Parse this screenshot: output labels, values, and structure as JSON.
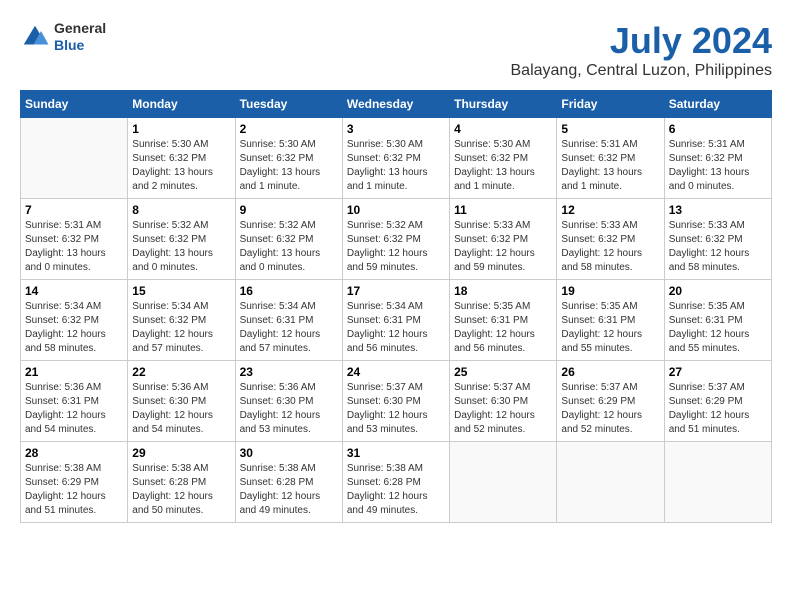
{
  "header": {
    "logo_general": "General",
    "logo_blue": "Blue",
    "main_title": "July 2024",
    "sub_title": "Balayang, Central Luzon, Philippines"
  },
  "calendar": {
    "days_of_week": [
      "Sunday",
      "Monday",
      "Tuesday",
      "Wednesday",
      "Thursday",
      "Friday",
      "Saturday"
    ],
    "weeks": [
      [
        {
          "day": "",
          "info": ""
        },
        {
          "day": "1",
          "info": "Sunrise: 5:30 AM\nSunset: 6:32 PM\nDaylight: 13 hours\nand 2 minutes."
        },
        {
          "day": "2",
          "info": "Sunrise: 5:30 AM\nSunset: 6:32 PM\nDaylight: 13 hours\nand 1 minute."
        },
        {
          "day": "3",
          "info": "Sunrise: 5:30 AM\nSunset: 6:32 PM\nDaylight: 13 hours\nand 1 minute."
        },
        {
          "day": "4",
          "info": "Sunrise: 5:30 AM\nSunset: 6:32 PM\nDaylight: 13 hours\nand 1 minute."
        },
        {
          "day": "5",
          "info": "Sunrise: 5:31 AM\nSunset: 6:32 PM\nDaylight: 13 hours\nand 1 minute."
        },
        {
          "day": "6",
          "info": "Sunrise: 5:31 AM\nSunset: 6:32 PM\nDaylight: 13 hours\nand 0 minutes."
        }
      ],
      [
        {
          "day": "7",
          "info": "Sunrise: 5:31 AM\nSunset: 6:32 PM\nDaylight: 13 hours\nand 0 minutes."
        },
        {
          "day": "8",
          "info": "Sunrise: 5:32 AM\nSunset: 6:32 PM\nDaylight: 13 hours\nand 0 minutes."
        },
        {
          "day": "9",
          "info": "Sunrise: 5:32 AM\nSunset: 6:32 PM\nDaylight: 13 hours\nand 0 minutes."
        },
        {
          "day": "10",
          "info": "Sunrise: 5:32 AM\nSunset: 6:32 PM\nDaylight: 12 hours\nand 59 minutes."
        },
        {
          "day": "11",
          "info": "Sunrise: 5:33 AM\nSunset: 6:32 PM\nDaylight: 12 hours\nand 59 minutes."
        },
        {
          "day": "12",
          "info": "Sunrise: 5:33 AM\nSunset: 6:32 PM\nDaylight: 12 hours\nand 58 minutes."
        },
        {
          "day": "13",
          "info": "Sunrise: 5:33 AM\nSunset: 6:32 PM\nDaylight: 12 hours\nand 58 minutes."
        }
      ],
      [
        {
          "day": "14",
          "info": "Sunrise: 5:34 AM\nSunset: 6:32 PM\nDaylight: 12 hours\nand 58 minutes."
        },
        {
          "day": "15",
          "info": "Sunrise: 5:34 AM\nSunset: 6:32 PM\nDaylight: 12 hours\nand 57 minutes."
        },
        {
          "day": "16",
          "info": "Sunrise: 5:34 AM\nSunset: 6:31 PM\nDaylight: 12 hours\nand 57 minutes."
        },
        {
          "day": "17",
          "info": "Sunrise: 5:34 AM\nSunset: 6:31 PM\nDaylight: 12 hours\nand 56 minutes."
        },
        {
          "day": "18",
          "info": "Sunrise: 5:35 AM\nSunset: 6:31 PM\nDaylight: 12 hours\nand 56 minutes."
        },
        {
          "day": "19",
          "info": "Sunrise: 5:35 AM\nSunset: 6:31 PM\nDaylight: 12 hours\nand 55 minutes."
        },
        {
          "day": "20",
          "info": "Sunrise: 5:35 AM\nSunset: 6:31 PM\nDaylight: 12 hours\nand 55 minutes."
        }
      ],
      [
        {
          "day": "21",
          "info": "Sunrise: 5:36 AM\nSunset: 6:31 PM\nDaylight: 12 hours\nand 54 minutes."
        },
        {
          "day": "22",
          "info": "Sunrise: 5:36 AM\nSunset: 6:30 PM\nDaylight: 12 hours\nand 54 minutes."
        },
        {
          "day": "23",
          "info": "Sunrise: 5:36 AM\nSunset: 6:30 PM\nDaylight: 12 hours\nand 53 minutes."
        },
        {
          "day": "24",
          "info": "Sunrise: 5:37 AM\nSunset: 6:30 PM\nDaylight: 12 hours\nand 53 minutes."
        },
        {
          "day": "25",
          "info": "Sunrise: 5:37 AM\nSunset: 6:30 PM\nDaylight: 12 hours\nand 52 minutes."
        },
        {
          "day": "26",
          "info": "Sunrise: 5:37 AM\nSunset: 6:29 PM\nDaylight: 12 hours\nand 52 minutes."
        },
        {
          "day": "27",
          "info": "Sunrise: 5:37 AM\nSunset: 6:29 PM\nDaylight: 12 hours\nand 51 minutes."
        }
      ],
      [
        {
          "day": "28",
          "info": "Sunrise: 5:38 AM\nSunset: 6:29 PM\nDaylight: 12 hours\nand 51 minutes."
        },
        {
          "day": "29",
          "info": "Sunrise: 5:38 AM\nSunset: 6:28 PM\nDaylight: 12 hours\nand 50 minutes."
        },
        {
          "day": "30",
          "info": "Sunrise: 5:38 AM\nSunset: 6:28 PM\nDaylight: 12 hours\nand 49 minutes."
        },
        {
          "day": "31",
          "info": "Sunrise: 5:38 AM\nSunset: 6:28 PM\nDaylight: 12 hours\nand 49 minutes."
        },
        {
          "day": "",
          "info": ""
        },
        {
          "day": "",
          "info": ""
        },
        {
          "day": "",
          "info": ""
        }
      ]
    ]
  }
}
